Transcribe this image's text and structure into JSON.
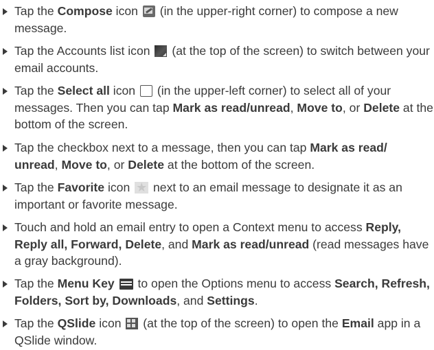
{
  "items": [
    {
      "p1": "Tap the ",
      "b1": "Compose",
      "p2": " icon ",
      "icon": "compose-icon",
      "p3": " (in the upper-right corner) to compose a new message."
    },
    {
      "p1": "Tap the Accounts list icon ",
      "icon": "accounts-list-icon",
      "p2": " (at the top of the screen) to switch between your email accounts."
    },
    {
      "p1": "Tap the ",
      "b1": "Select all",
      "p2": " icon ",
      "icon": "select-all-icon",
      "p3": " (in the upper-left corner) to select all of your messages. Then you can tap ",
      "b2": "Mark as read/unread",
      "p4": ", ",
      "b3": "Move to",
      "p5": ", or ",
      "b4": "Delete",
      "p6": " at the bottom of the screen."
    },
    {
      "p1": "Tap the checkbox next to a message, then you can tap ",
      "b1": "Mark as read/ unread",
      "p2": ", ",
      "b2": "Move to",
      "p3": ", or ",
      "b3": "Delete",
      "p4": " at the bottom of the screen."
    },
    {
      "p1": "Tap the ",
      "b1": "Favorite",
      "p2": " icon ",
      "icon": "favorite-star-icon",
      "p3": " next to an email message to designate it as an important or favorite message."
    },
    {
      "p1": "Touch and hold an email entry to open a Context menu to access ",
      "b1": "Reply, Reply all, Forward, Delete",
      "p2": ", and ",
      "b2": "Mark as read/unread",
      "p3": " (read messages have a gray background)."
    },
    {
      "p1": "Tap the ",
      "b1": "Menu Key",
      "p2": " ",
      "icon": "menu-key-icon",
      "p3": " to open the Options menu to access ",
      "b2": "Search, Refresh, Folders, Sort by, Downloads",
      "p4": ", and ",
      "b3": "Settings",
      "p5": "."
    },
    {
      "p1": "Tap the ",
      "b1": "QSlide",
      "p2": " icon ",
      "icon": "qslide-icon",
      "p3": " (at the top of the screen) to open the ",
      "b2": "Email",
      "p4": " app in a QSlide window."
    }
  ]
}
